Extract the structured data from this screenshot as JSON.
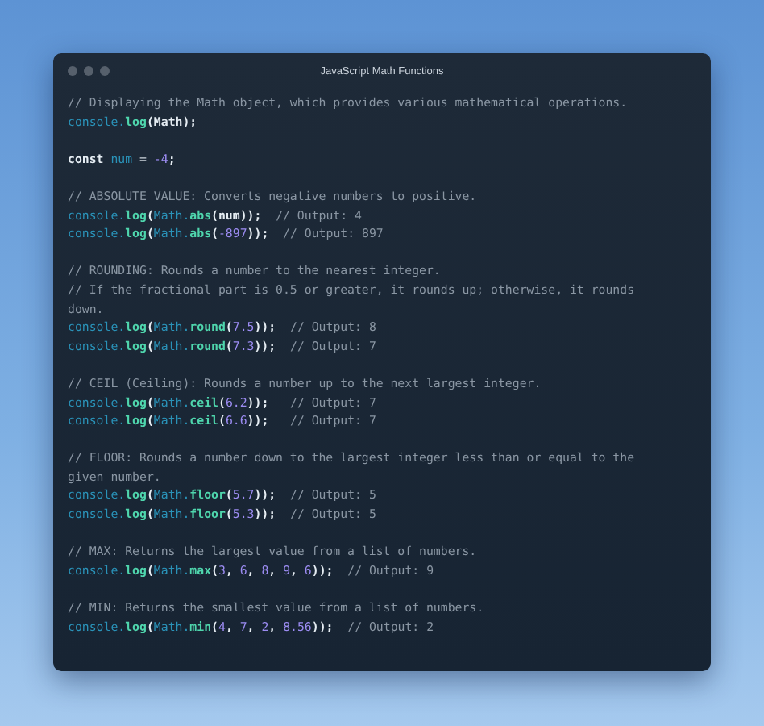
{
  "window": {
    "title": "JavaScript Math Functions"
  },
  "code_blocks": [
    [
      [
        {
          "kind": "comment",
          "text": "// Displaying the Math object, which provides various mathematical operations."
        }
      ],
      [
        {
          "kind": "object",
          "text": "console."
        },
        {
          "kind": "method",
          "text": "log"
        },
        {
          "kind": "punct",
          "text": "(Math);"
        }
      ]
    ],
    [
      [
        {
          "kind": "keyword",
          "text": "const "
        },
        {
          "kind": "object",
          "text": "num"
        },
        {
          "kind": "plain",
          "text": " = "
        },
        {
          "kind": "number",
          "text": "-4"
        },
        {
          "kind": "punct",
          "text": ";"
        }
      ]
    ],
    [
      [
        {
          "kind": "comment",
          "text": "// ABSOLUTE VALUE: Converts negative numbers to positive."
        }
      ],
      [
        {
          "kind": "object",
          "text": "console."
        },
        {
          "kind": "method",
          "text": "log"
        },
        {
          "kind": "punct",
          "text": "("
        },
        {
          "kind": "object",
          "text": "Math."
        },
        {
          "kind": "method",
          "text": "abs"
        },
        {
          "kind": "punct",
          "text": "(num));"
        },
        {
          "kind": "comment",
          "text": "  // Output: 4"
        }
      ],
      [
        {
          "kind": "object",
          "text": "console."
        },
        {
          "kind": "method",
          "text": "log"
        },
        {
          "kind": "punct",
          "text": "("
        },
        {
          "kind": "object",
          "text": "Math."
        },
        {
          "kind": "method",
          "text": "abs"
        },
        {
          "kind": "punct",
          "text": "("
        },
        {
          "kind": "number",
          "text": "-897"
        },
        {
          "kind": "punct",
          "text": "));"
        },
        {
          "kind": "comment",
          "text": "  // Output: 897"
        }
      ]
    ],
    [
      [
        {
          "kind": "comment",
          "text": "// ROUNDING: Rounds a number to the nearest integer."
        }
      ],
      [
        {
          "kind": "comment",
          "text": "// If the fractional part is 0.5 or greater, it rounds up; otherwise, it rounds"
        }
      ],
      [
        {
          "kind": "comment",
          "text": "down."
        }
      ],
      [
        {
          "kind": "object",
          "text": "console."
        },
        {
          "kind": "method",
          "text": "log"
        },
        {
          "kind": "punct",
          "text": "("
        },
        {
          "kind": "object",
          "text": "Math."
        },
        {
          "kind": "method",
          "text": "round"
        },
        {
          "kind": "punct",
          "text": "("
        },
        {
          "kind": "number",
          "text": "7.5"
        },
        {
          "kind": "punct",
          "text": "));"
        },
        {
          "kind": "comment",
          "text": "  // Output: 8"
        }
      ],
      [
        {
          "kind": "object",
          "text": "console."
        },
        {
          "kind": "method",
          "text": "log"
        },
        {
          "kind": "punct",
          "text": "("
        },
        {
          "kind": "object",
          "text": "Math."
        },
        {
          "kind": "method",
          "text": "round"
        },
        {
          "kind": "punct",
          "text": "("
        },
        {
          "kind": "number",
          "text": "7.3"
        },
        {
          "kind": "punct",
          "text": "));"
        },
        {
          "kind": "comment",
          "text": "  // Output: 7"
        }
      ]
    ],
    [
      [
        {
          "kind": "comment",
          "text": "// CEIL (Ceiling): Rounds a number up to the next largest integer."
        }
      ],
      [
        {
          "kind": "object",
          "text": "console."
        },
        {
          "kind": "method",
          "text": "log"
        },
        {
          "kind": "punct",
          "text": "("
        },
        {
          "kind": "object",
          "text": "Math."
        },
        {
          "kind": "method",
          "text": "ceil"
        },
        {
          "kind": "punct",
          "text": "("
        },
        {
          "kind": "number",
          "text": "6.2"
        },
        {
          "kind": "punct",
          "text": "));"
        },
        {
          "kind": "comment",
          "text": "   // Output: 7"
        }
      ],
      [
        {
          "kind": "object",
          "text": "console."
        },
        {
          "kind": "method",
          "text": "log"
        },
        {
          "kind": "punct",
          "text": "("
        },
        {
          "kind": "object",
          "text": "Math."
        },
        {
          "kind": "method",
          "text": "ceil"
        },
        {
          "kind": "punct",
          "text": "("
        },
        {
          "kind": "number",
          "text": "6.6"
        },
        {
          "kind": "punct",
          "text": "));"
        },
        {
          "kind": "comment",
          "text": "   // Output: 7"
        }
      ]
    ],
    [
      [
        {
          "kind": "comment",
          "text": "// FLOOR: Rounds a number down to the largest integer less than or equal to the"
        }
      ],
      [
        {
          "kind": "comment",
          "text": "given number."
        }
      ],
      [
        {
          "kind": "object",
          "text": "console."
        },
        {
          "kind": "method",
          "text": "log"
        },
        {
          "kind": "punct",
          "text": "("
        },
        {
          "kind": "object",
          "text": "Math."
        },
        {
          "kind": "method",
          "text": "floor"
        },
        {
          "kind": "punct",
          "text": "("
        },
        {
          "kind": "number",
          "text": "5.7"
        },
        {
          "kind": "punct",
          "text": "));"
        },
        {
          "kind": "comment",
          "text": "  // Output: 5"
        }
      ],
      [
        {
          "kind": "object",
          "text": "console."
        },
        {
          "kind": "method",
          "text": "log"
        },
        {
          "kind": "punct",
          "text": "("
        },
        {
          "kind": "object",
          "text": "Math."
        },
        {
          "kind": "method",
          "text": "floor"
        },
        {
          "kind": "punct",
          "text": "("
        },
        {
          "kind": "number",
          "text": "5.3"
        },
        {
          "kind": "punct",
          "text": "));"
        },
        {
          "kind": "comment",
          "text": "  // Output: 5"
        }
      ]
    ],
    [
      [
        {
          "kind": "comment",
          "text": "// MAX: Returns the largest value from a list of numbers."
        }
      ],
      [
        {
          "kind": "object",
          "text": "console."
        },
        {
          "kind": "method",
          "text": "log"
        },
        {
          "kind": "punct",
          "text": "("
        },
        {
          "kind": "object",
          "text": "Math."
        },
        {
          "kind": "method",
          "text": "max"
        },
        {
          "kind": "punct",
          "text": "("
        },
        {
          "kind": "number",
          "text": "3"
        },
        {
          "kind": "punct",
          "text": ", "
        },
        {
          "kind": "number",
          "text": "6"
        },
        {
          "kind": "punct",
          "text": ", "
        },
        {
          "kind": "number",
          "text": "8"
        },
        {
          "kind": "punct",
          "text": ", "
        },
        {
          "kind": "number",
          "text": "9"
        },
        {
          "kind": "punct",
          "text": ", "
        },
        {
          "kind": "number",
          "text": "6"
        },
        {
          "kind": "punct",
          "text": "));"
        },
        {
          "kind": "comment",
          "text": "  // Output: 9"
        }
      ]
    ],
    [
      [
        {
          "kind": "comment",
          "text": "// MIN: Returns the smallest value from a list of numbers."
        }
      ],
      [
        {
          "kind": "object",
          "text": "console."
        },
        {
          "kind": "method",
          "text": "log"
        },
        {
          "kind": "punct",
          "text": "("
        },
        {
          "kind": "object",
          "text": "Math."
        },
        {
          "kind": "method",
          "text": "min"
        },
        {
          "kind": "punct",
          "text": "("
        },
        {
          "kind": "number",
          "text": "4"
        },
        {
          "kind": "punct",
          "text": ", "
        },
        {
          "kind": "number",
          "text": "7"
        },
        {
          "kind": "punct",
          "text": ", "
        },
        {
          "kind": "number",
          "text": "2"
        },
        {
          "kind": "punct",
          "text": ", "
        },
        {
          "kind": "number",
          "text": "8.56"
        },
        {
          "kind": "punct",
          "text": "));"
        },
        {
          "kind": "comment",
          "text": "  // Output: 2"
        }
      ]
    ]
  ]
}
